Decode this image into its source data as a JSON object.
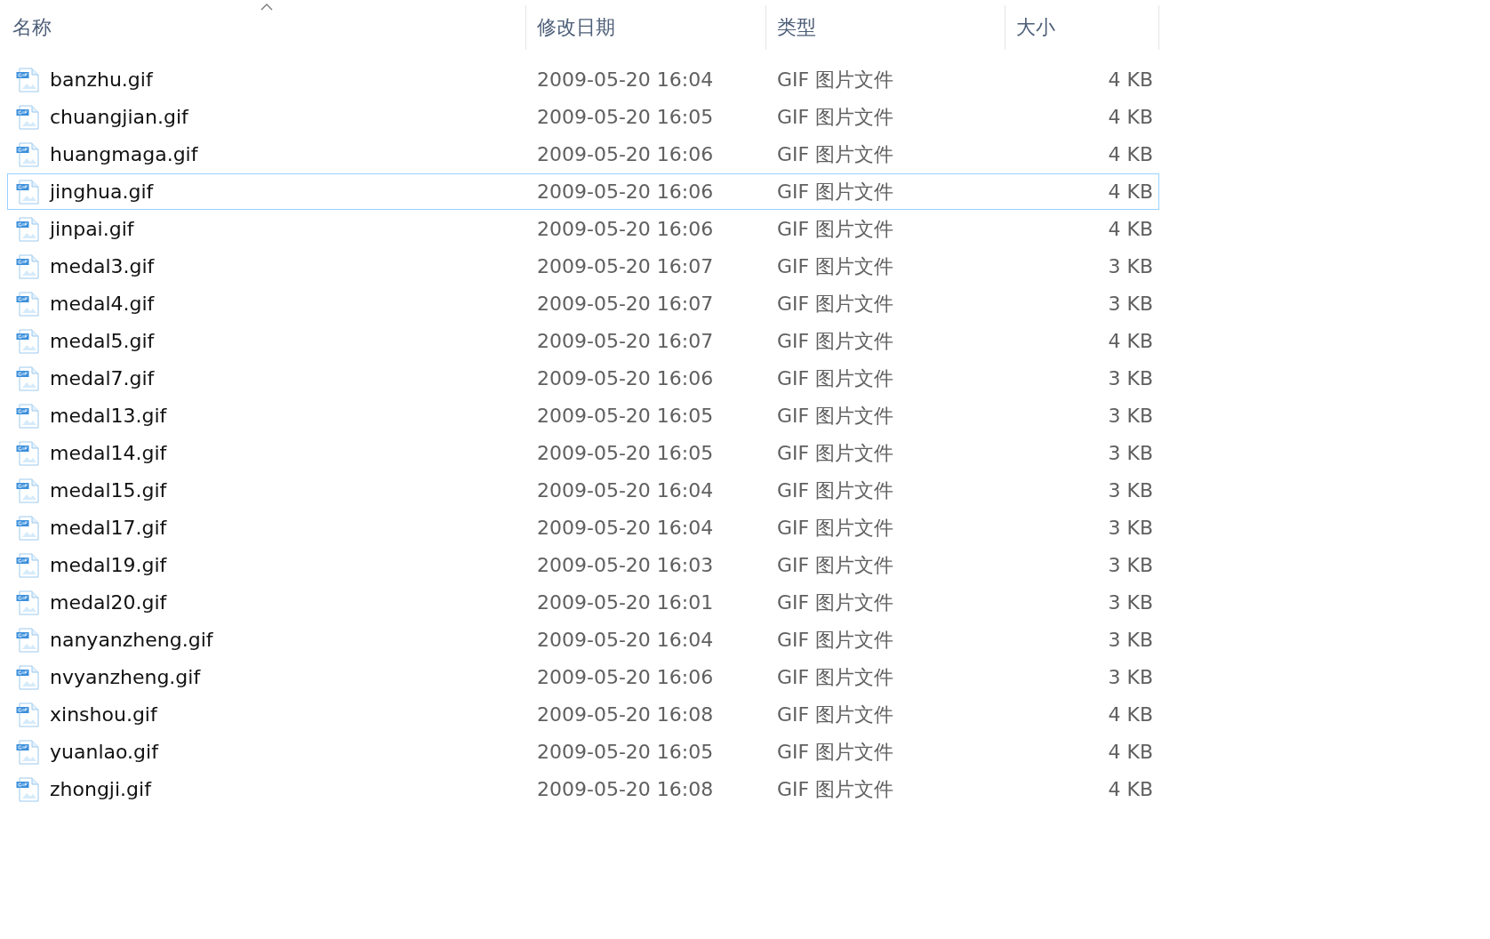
{
  "columns": [
    {
      "label": "名称",
      "sorted": true
    },
    {
      "label": "修改日期",
      "sorted": false
    },
    {
      "label": "类型",
      "sorted": false
    },
    {
      "label": "大小",
      "sorted": false
    }
  ],
  "files": [
    {
      "name": "banzhu.gif",
      "modified": "2009-05-20 16:04",
      "type": "GIF 图片文件",
      "size": "4 KB",
      "selected": false
    },
    {
      "name": "chuangjian.gif",
      "modified": "2009-05-20 16:05",
      "type": "GIF 图片文件",
      "size": "4 KB",
      "selected": false
    },
    {
      "name": "huangmaga.gif",
      "modified": "2009-05-20 16:06",
      "type": "GIF 图片文件",
      "size": "4 KB",
      "selected": false
    },
    {
      "name": "jinghua.gif",
      "modified": "2009-05-20 16:06",
      "type": "GIF 图片文件",
      "size": "4 KB",
      "selected": true
    },
    {
      "name": "jinpai.gif",
      "modified": "2009-05-20 16:06",
      "type": "GIF 图片文件",
      "size": "4 KB",
      "selected": false
    },
    {
      "name": "medal3.gif",
      "modified": "2009-05-20 16:07",
      "type": "GIF 图片文件",
      "size": "3 KB",
      "selected": false
    },
    {
      "name": "medal4.gif",
      "modified": "2009-05-20 16:07",
      "type": "GIF 图片文件",
      "size": "3 KB",
      "selected": false
    },
    {
      "name": "medal5.gif",
      "modified": "2009-05-20 16:07",
      "type": "GIF 图片文件",
      "size": "4 KB",
      "selected": false
    },
    {
      "name": "medal7.gif",
      "modified": "2009-05-20 16:06",
      "type": "GIF 图片文件",
      "size": "3 KB",
      "selected": false
    },
    {
      "name": "medal13.gif",
      "modified": "2009-05-20 16:05",
      "type": "GIF 图片文件",
      "size": "3 KB",
      "selected": false
    },
    {
      "name": "medal14.gif",
      "modified": "2009-05-20 16:05",
      "type": "GIF 图片文件",
      "size": "3 KB",
      "selected": false
    },
    {
      "name": "medal15.gif",
      "modified": "2009-05-20 16:04",
      "type": "GIF 图片文件",
      "size": "3 KB",
      "selected": false
    },
    {
      "name": "medal17.gif",
      "modified": "2009-05-20 16:04",
      "type": "GIF 图片文件",
      "size": "3 KB",
      "selected": false
    },
    {
      "name": "medal19.gif",
      "modified": "2009-05-20 16:03",
      "type": "GIF 图片文件",
      "size": "3 KB",
      "selected": false
    },
    {
      "name": "medal20.gif",
      "modified": "2009-05-20 16:01",
      "type": "GIF 图片文件",
      "size": "3 KB",
      "selected": false
    },
    {
      "name": "nanyanzheng.gif",
      "modified": "2009-05-20 16:04",
      "type": "GIF 图片文件",
      "size": "3 KB",
      "selected": false
    },
    {
      "name": "nvyanzheng.gif",
      "modified": "2009-05-20 16:06",
      "type": "GIF 图片文件",
      "size": "3 KB",
      "selected": false
    },
    {
      "name": "xinshou.gif",
      "modified": "2009-05-20 16:08",
      "type": "GIF 图片文件",
      "size": "4 KB",
      "selected": false
    },
    {
      "name": "yuanlao.gif",
      "modified": "2009-05-20 16:05",
      "type": "GIF 图片文件",
      "size": "4 KB",
      "selected": false
    },
    {
      "name": "zhongji.gif",
      "modified": "2009-05-20 16:08",
      "type": "GIF 图片文件",
      "size": "4 KB",
      "selected": false
    }
  ]
}
